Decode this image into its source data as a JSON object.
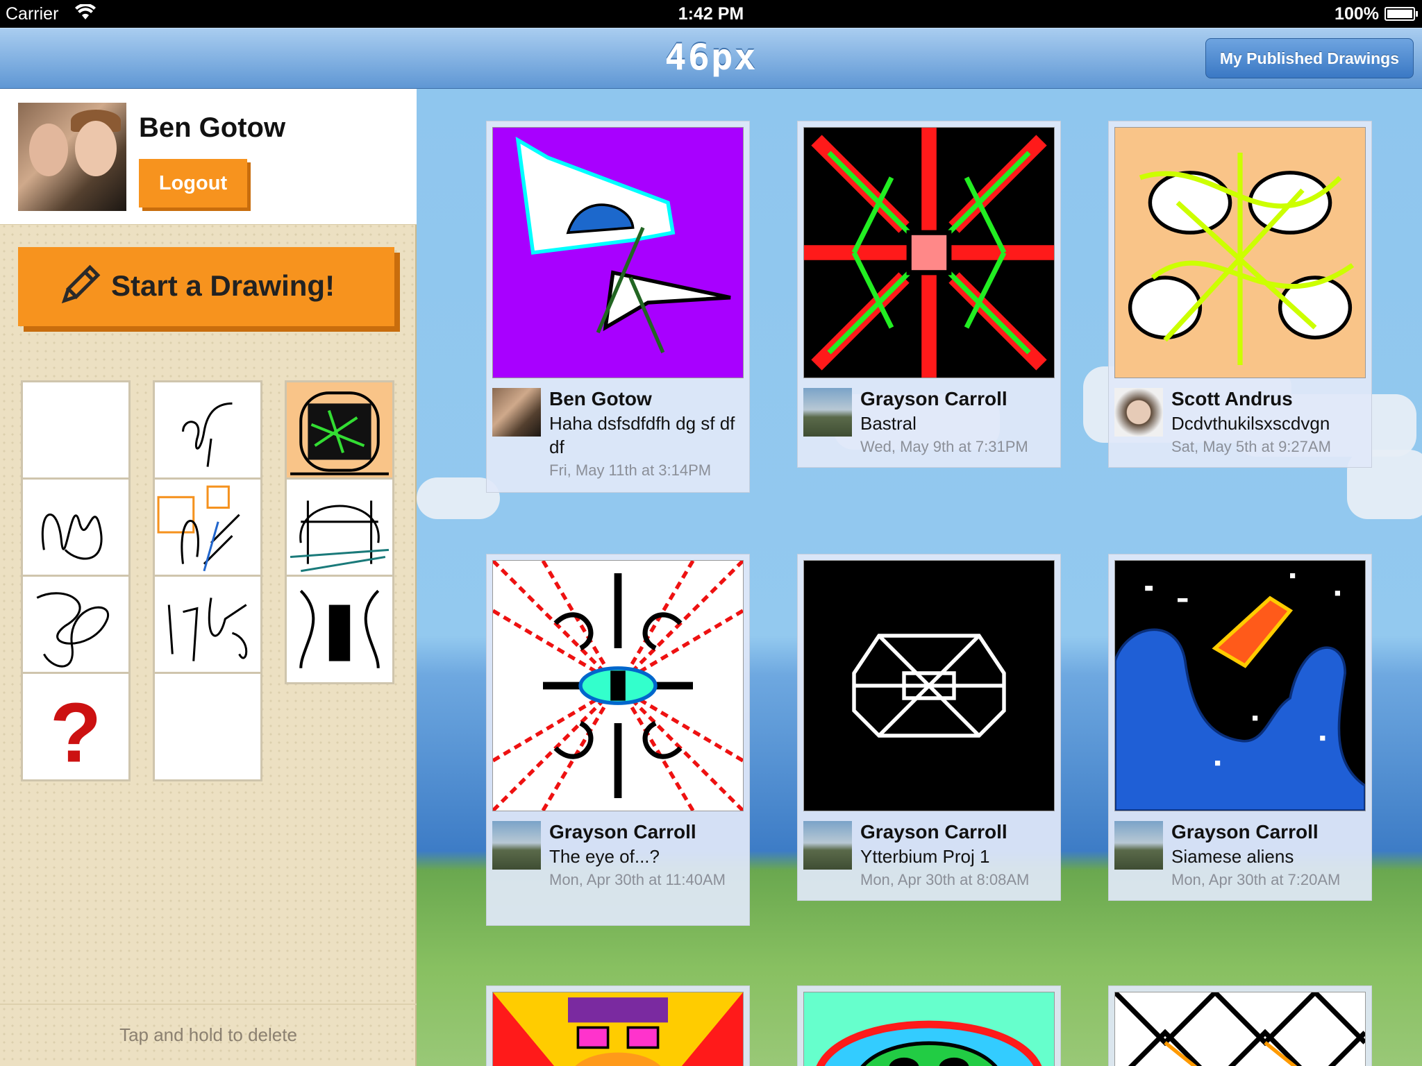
{
  "status_bar": {
    "carrier": "Carrier",
    "time": "1:42 PM",
    "battery": "100%"
  },
  "nav": {
    "title": "46px",
    "published_button": "My Published Drawings"
  },
  "profile": {
    "name": "Ben Gotow",
    "logout_label": "Logout"
  },
  "start_drawing": {
    "label": "Start a Drawing!"
  },
  "sidebar": {
    "hint": "Tap and hold to delete"
  },
  "cards": [
    {
      "author": "Ben Gotow",
      "caption": "Haha dsfsdfdfh dg sf df df",
      "date": "Fri, May 11th at 3:14PM"
    },
    {
      "author": "Grayson Carroll",
      "caption": "Bastral",
      "date": "Wed, May 9th at 7:31PM"
    },
    {
      "author": "Scott Andrus",
      "caption": "Dcdvthukilsxscdvgn",
      "date": "Sat, May 5th at 9:27AM"
    },
    {
      "author": "Grayson Carroll",
      "caption": "The eye of...?",
      "date": "Mon, Apr 30th at 11:40AM"
    },
    {
      "author": "Grayson Carroll",
      "caption": "Ytterbium Proj 1",
      "date": "Mon, Apr 30th at 8:08AM"
    },
    {
      "author": "Grayson Carroll",
      "caption": "Siamese aliens",
      "date": "Mon, Apr 30th at 7:20AM"
    }
  ]
}
